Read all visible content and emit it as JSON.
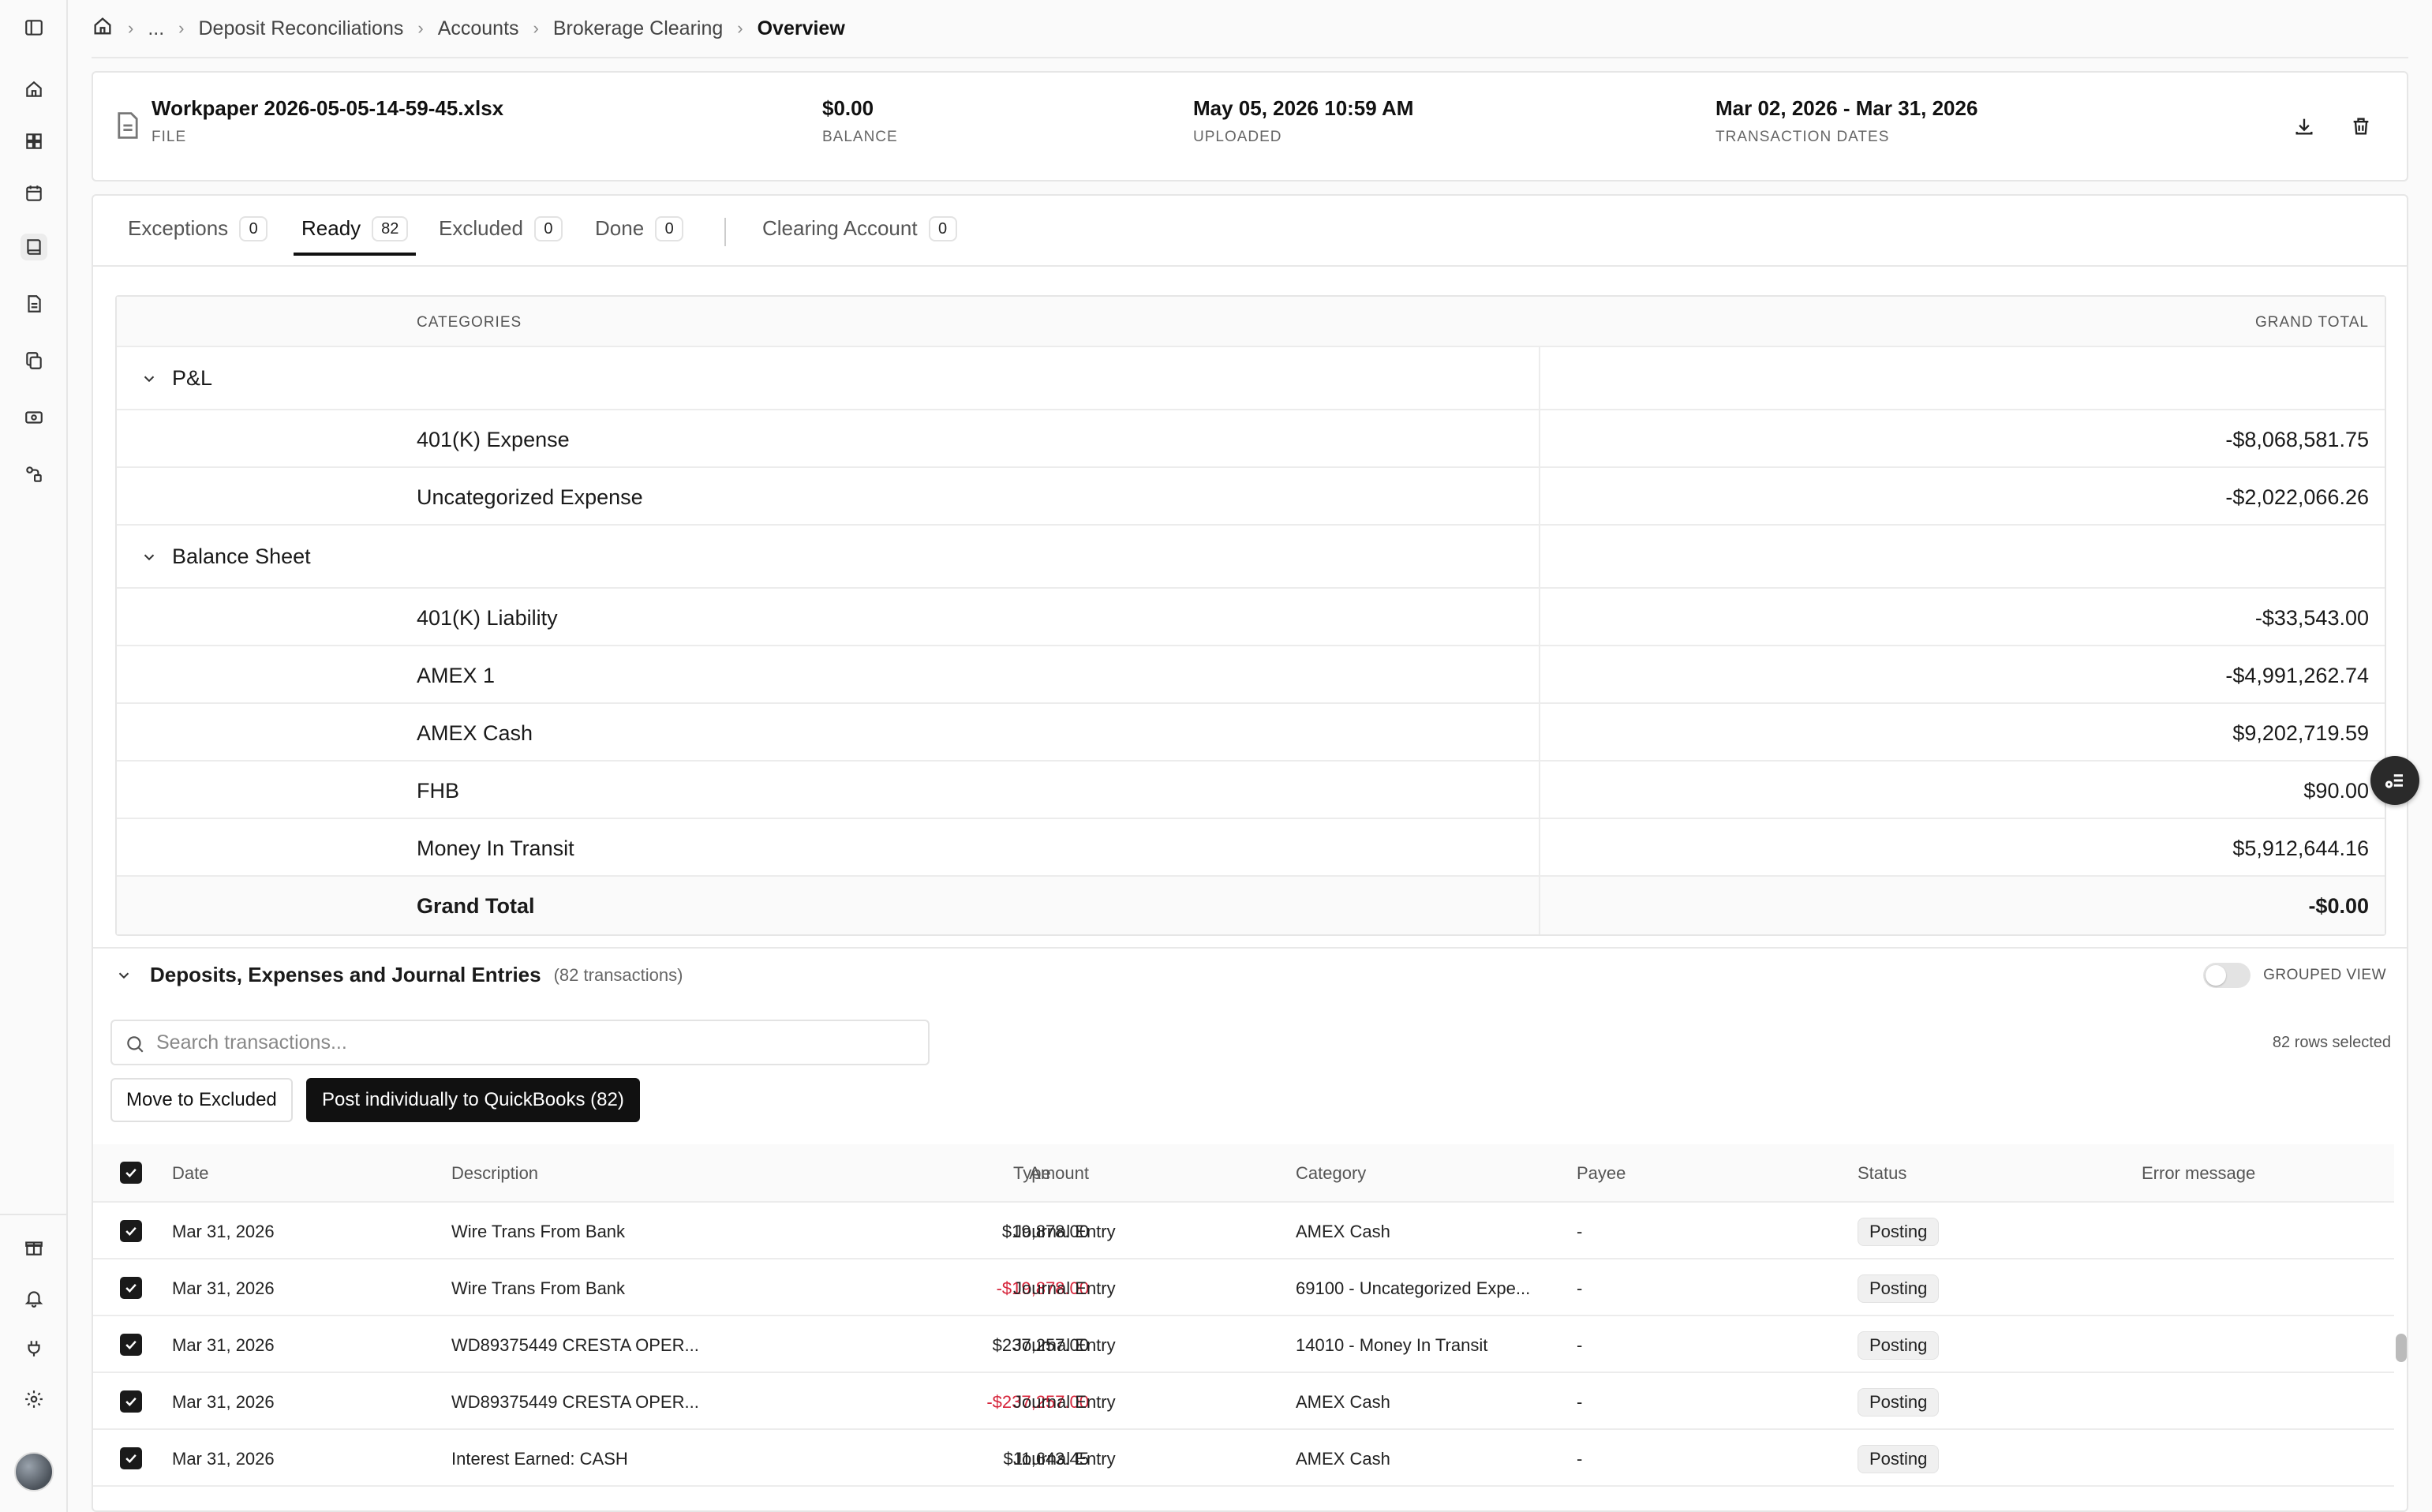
{
  "breadcrumb": {
    "ellipsis": "...",
    "items": [
      "Deposit Reconciliations",
      "Accounts",
      "Brokerage Clearing"
    ],
    "current": "Overview"
  },
  "file": {
    "name": "Workpaper 2026-05-05-14-59-45.xlsx",
    "name_label": "FILE",
    "balance": "$0.00",
    "balance_label": "BALANCE",
    "uploaded": "May 05, 2026 10:59 AM",
    "uploaded_label": "UPLOADED",
    "dates": "Mar 02, 2026 - Mar 31, 2026",
    "dates_label": "TRANSACTION DATES"
  },
  "tabs": [
    {
      "label": "Exceptions",
      "count": "0"
    },
    {
      "label": "Ready",
      "count": "82"
    },
    {
      "label": "Excluded",
      "count": "0"
    },
    {
      "label": "Done",
      "count": "0"
    },
    {
      "label": "Clearing Account",
      "count": "0"
    }
  ],
  "summary": {
    "col_categories": "CATEGORIES",
    "col_total": "GRAND TOTAL",
    "groups": [
      {
        "name": "P&L",
        "rows": [
          {
            "category": "401(K) Expense",
            "amount": "-$8,068,581.75"
          },
          {
            "category": "Uncategorized Expense",
            "amount": "-$2,022,066.26"
          }
        ]
      },
      {
        "name": "Balance Sheet",
        "rows": [
          {
            "category": "401(K) Liability",
            "amount": "-$33,543.00"
          },
          {
            "category": "AMEX 1",
            "amount": "-$4,991,262.74"
          },
          {
            "category": "AMEX Cash",
            "amount": "$9,202,719.59"
          },
          {
            "category": "FHB",
            "amount": "$90.00"
          },
          {
            "category": "Money In Transit",
            "amount": "$5,912,644.16"
          }
        ]
      }
    ],
    "grand_total_label": "Grand Total",
    "grand_total": "-$0.00"
  },
  "transactions": {
    "title": "Deposits, Expenses and Journal Entries",
    "count_text": "(82 transactions)",
    "grouped_view_label": "GROUPED VIEW",
    "search_placeholder": "Search transactions...",
    "rows_selected": "82 rows selected",
    "move_button": "Move to Excluded",
    "post_button": "Post individually to QuickBooks (82)",
    "columns": {
      "date": "Date",
      "description": "Description",
      "amount": "Amount",
      "type": "Type",
      "category": "Category",
      "payee": "Payee",
      "status": "Status",
      "error": "Error message"
    },
    "rows": [
      {
        "date": "Mar 31, 2026",
        "description": "Wire Trans From Bank",
        "amount": "$19,878.00",
        "negative": false,
        "type": "Journal Entry",
        "category": "AMEX Cash",
        "payee": "-",
        "status": "Posting",
        "error": ""
      },
      {
        "date": "Mar 31, 2026",
        "description": "Wire Trans From Bank",
        "amount": "-$19,878.00",
        "negative": true,
        "type": "Journal Entry",
        "category": "69100 - Uncategorized Expe...",
        "payee": "-",
        "status": "Posting",
        "error": ""
      },
      {
        "date": "Mar 31, 2026",
        "description": "WD89375449 CRESTA OPER...",
        "amount": "$237,257.00",
        "negative": false,
        "type": "Journal Entry",
        "category": "14010 - Money In Transit",
        "payee": "-",
        "status": "Posting",
        "error": ""
      },
      {
        "date": "Mar 31, 2026",
        "description": "WD89375449 CRESTA OPER...",
        "amount": "-$237,257.00",
        "negative": true,
        "type": "Journal Entry",
        "category": "AMEX Cash",
        "payee": "-",
        "status": "Posting",
        "error": ""
      },
      {
        "date": "Mar 31, 2026",
        "description": "Interest Earned: CASH",
        "amount": "$11,643.45",
        "negative": false,
        "type": "Journal Entry",
        "category": "AMEX Cash",
        "payee": "-",
        "status": "Posting",
        "error": ""
      }
    ]
  },
  "icons": {
    "sidebar_top": [
      "sidebar-toggle-icon"
    ],
    "sidebar_nav": [
      "home-icon",
      "dashboard-icon",
      "calendar-icon",
      "book-icon",
      "document-icon",
      "copy-icon",
      "cash-icon",
      "workflow-icon"
    ],
    "sidebar_bottom": [
      "gift-icon",
      "bell-icon",
      "plug-icon",
      "gear-icon"
    ]
  }
}
